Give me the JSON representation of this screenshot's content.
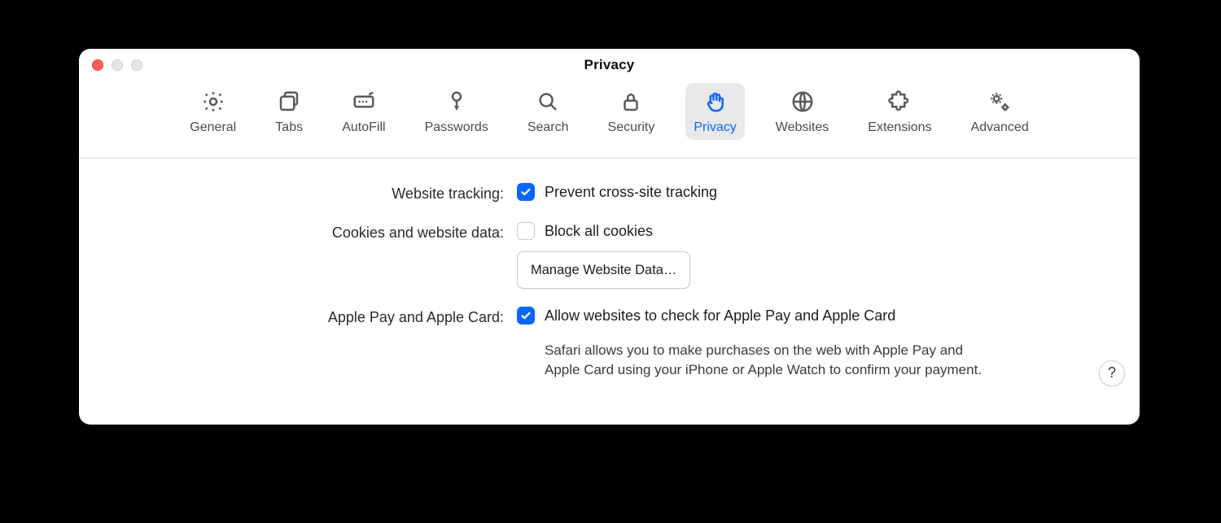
{
  "window": {
    "title": "Privacy"
  },
  "toolbar": {
    "active_index": 6,
    "tabs": [
      {
        "label": "General",
        "icon": "gear-icon"
      },
      {
        "label": "Tabs",
        "icon": "tabs-icon"
      },
      {
        "label": "AutoFill",
        "icon": "autofill-icon"
      },
      {
        "label": "Passwords",
        "icon": "key-icon"
      },
      {
        "label": "Search",
        "icon": "search-icon"
      },
      {
        "label": "Security",
        "icon": "lock-icon"
      },
      {
        "label": "Privacy",
        "icon": "hand-icon"
      },
      {
        "label": "Websites",
        "icon": "globe-icon"
      },
      {
        "label": "Extensions",
        "icon": "puzzle-icon"
      },
      {
        "label": "Advanced",
        "icon": "gears-icon"
      }
    ]
  },
  "panel": {
    "help_label": "?",
    "rows": [
      {
        "label": "Website tracking:",
        "option": "Prevent cross-site tracking",
        "checked": true
      },
      {
        "label": "Cookies and website data:",
        "option": "Block all cookies",
        "checked": false,
        "button": "Manage Website Data…"
      },
      {
        "label": "Apple Pay and Apple Card:",
        "option": "Allow websites to check for Apple Pay and Apple Card",
        "checked": true,
        "description": "Safari allows you to make purchases on the web with Apple Pay and Apple Card using your iPhone or Apple Watch to confirm your payment."
      }
    ]
  },
  "colors": {
    "accent": "#0a66ff"
  }
}
